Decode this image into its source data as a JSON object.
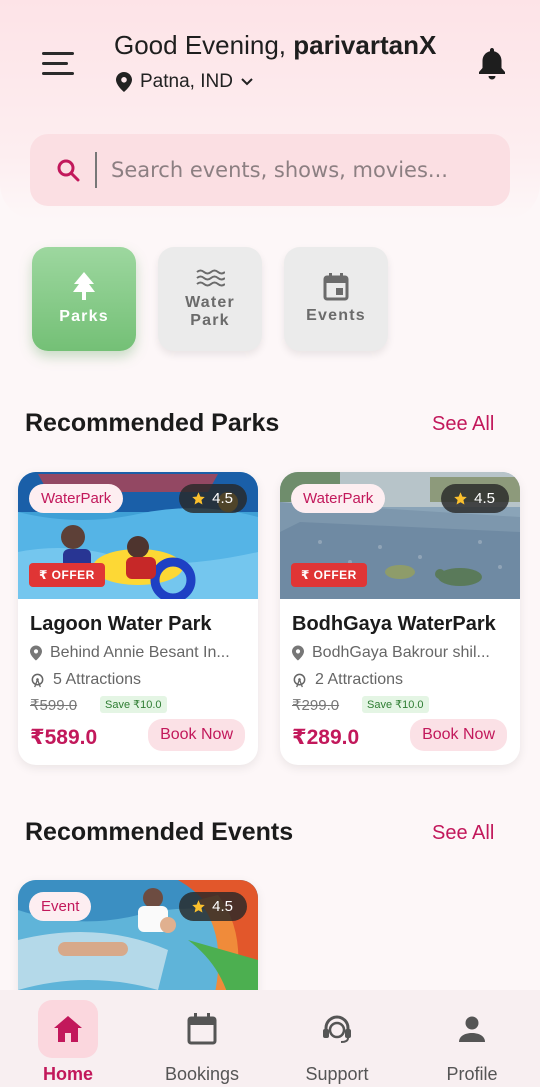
{
  "header": {
    "greeting": "Good Evening, ",
    "username": "parivartanX",
    "location": "Patna, IND"
  },
  "search": {
    "placeholder": "Search events, shows, movies..."
  },
  "categories": [
    {
      "label": "Parks",
      "active": true
    },
    {
      "label": "Water\nPark",
      "active": false
    },
    {
      "label": "Events",
      "active": false
    }
  ],
  "recommended_parks": {
    "title": "Recommended Parks",
    "see_all": "See All",
    "cards": [
      {
        "tag": "WaterPark",
        "rating": "4.5",
        "offer": "₹ OFFER",
        "name": "Lagoon Water Park",
        "address": "Behind Annie Besant In...",
        "attractions": "5 Attractions",
        "old_price": "₹599.0",
        "save": "Save ₹10.0",
        "price": "₹589.0",
        "book": "Book Now"
      },
      {
        "tag": "WaterPark",
        "rating": "4.5",
        "offer": "₹ OFFER",
        "name": "BodhGaya WaterPark",
        "address": "BodhGaya Bakrour shil...",
        "attractions": "2 Attractions",
        "old_price": "₹299.0",
        "save": "Save ₹10.0",
        "price": "₹289.0",
        "book": "Book Now"
      }
    ]
  },
  "recommended_events": {
    "title": "Recommended Events",
    "see_all": "See All",
    "cards": [
      {
        "tag": "Event",
        "rating": "4.5"
      }
    ]
  },
  "bottom_nav": [
    {
      "label": "Home",
      "icon": "home-icon",
      "active": true
    },
    {
      "label": "Bookings",
      "icon": "calendar-icon",
      "active": false
    },
    {
      "label": "Support",
      "icon": "support-icon",
      "active": false
    },
    {
      "label": "Profile",
      "icon": "person-icon",
      "active": false
    }
  ],
  "colors": {
    "accent": "#c2185b",
    "active_category": "#82c884",
    "offer_red": "#e03535"
  }
}
